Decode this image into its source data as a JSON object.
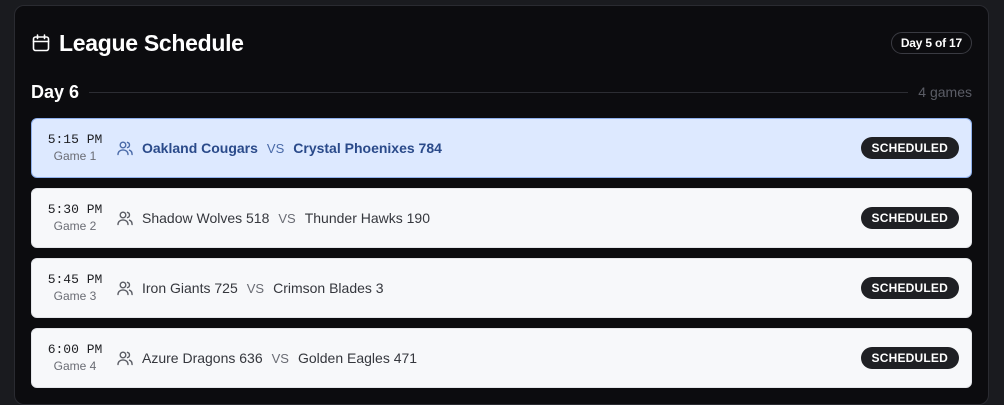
{
  "header": {
    "title": "League Schedule",
    "icon": "calendar-icon",
    "day_badge": "Day 5 of 17"
  },
  "day": {
    "label": "Day 6",
    "count": "4 games"
  },
  "colors": {
    "panel_bg": "#0c0c0f",
    "card_bg": "#f7f8fa",
    "active_card_bg": "#dde9ff",
    "active_text": "#2a4a8a",
    "status_bg": "#1f2024"
  },
  "games": [
    {
      "time": "5:15 PM",
      "game_no": "Game 1",
      "home": "Oakland Cougars",
      "vs": "VS",
      "away": "Crystal Phoenixes 784",
      "status": "SCHEDULED",
      "selected": true
    },
    {
      "time": "5:30 PM",
      "game_no": "Game 2",
      "home": "Shadow Wolves 518",
      "vs": "VS",
      "away": "Thunder Hawks 190",
      "status": "SCHEDULED",
      "selected": false
    },
    {
      "time": "5:45 PM",
      "game_no": "Game 3",
      "home": "Iron Giants 725",
      "vs": "VS",
      "away": "Crimson Blades 3",
      "status": "SCHEDULED",
      "selected": false
    },
    {
      "time": "6:00 PM",
      "game_no": "Game 4",
      "home": "Azure Dragons 636",
      "vs": "VS",
      "away": "Golden Eagles 471",
      "status": "SCHEDULED",
      "selected": false
    }
  ]
}
